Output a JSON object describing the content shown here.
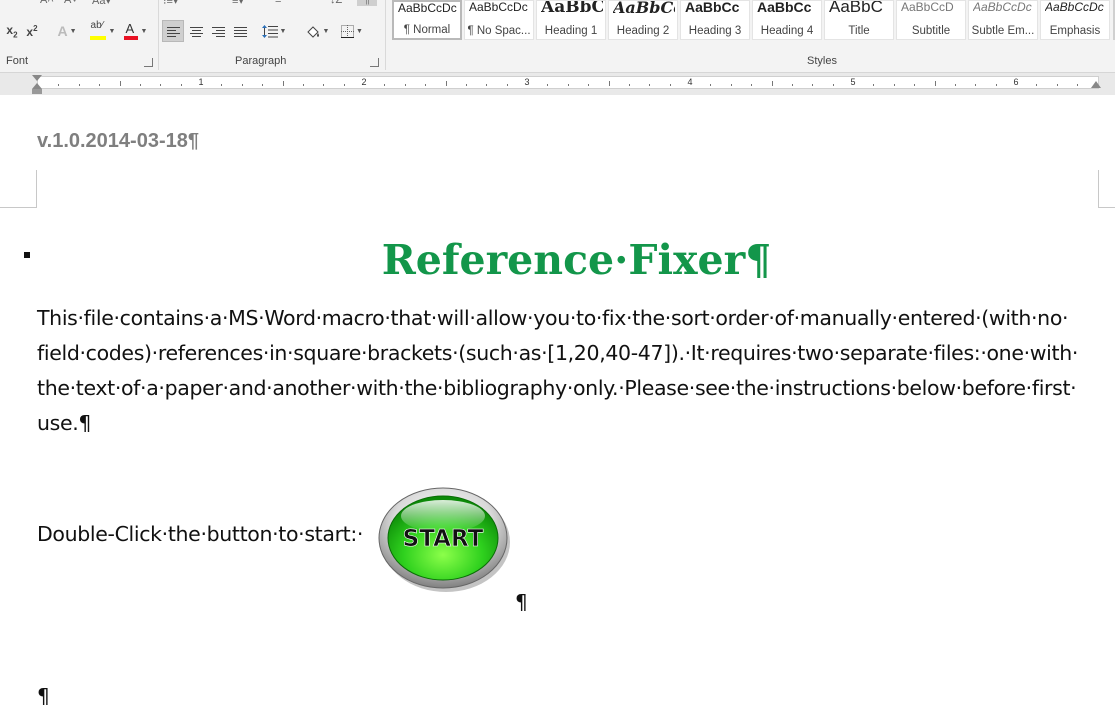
{
  "ribbon": {
    "font_group_label": "Font",
    "paragraph_group_label": "Paragraph",
    "styles_group_label": "Styles",
    "styles": [
      {
        "preview": "AaBbCcDc",
        "name": "¶ Normal",
        "selected": true
      },
      {
        "preview": "AaBbCcDc",
        "name": "¶ No Spac..."
      },
      {
        "preview": "AaBbC(",
        "name": "Heading 1"
      },
      {
        "preview": "AaBbCc",
        "name": "Heading 2"
      },
      {
        "preview": "AaBbCc",
        "name": "Heading 3"
      },
      {
        "preview": "AaBbCc",
        "name": "Heading 4"
      },
      {
        "preview": "AaBbC",
        "name": "Title"
      },
      {
        "preview": "AaBbCcD",
        "name": "Subtitle"
      },
      {
        "preview": "AaBbCcDc",
        "name": "Subtle Em..."
      },
      {
        "preview": "AaBbCcDc",
        "name": "Emphasis"
      }
    ],
    "icons": {
      "subscript": "subscript-icon",
      "superscript": "superscript-icon",
      "text_effects": "text-effects-icon",
      "highlight": "highlight-icon",
      "font_color": "font-color-icon",
      "align_left": "align-left-icon",
      "align_center": "align-center-icon",
      "align_right": "align-right-icon",
      "justify": "justify-icon",
      "line_spacing": "line-spacing-icon",
      "shading": "shading-icon",
      "borders": "borders-icon"
    },
    "colors": {
      "highlight": "#ffff00",
      "font_color": "#e81123"
    }
  },
  "ruler": {
    "numbers": [
      "1",
      "2",
      "3",
      "4",
      "5",
      "6"
    ]
  },
  "document": {
    "header_text": "v.1.0.2014-03-18¶",
    "title": "Reference·Fixer¶",
    "title_color": "#13964a",
    "body_lines": [
      "This·file·contains·a·MS·Word·macro·that·will·allow·you·to·fix·the·sort·order·of·manually·entered·(with·no·",
      "field·codes)·references·in·square·brackets·(such·as·[1,20,40-47]).·It·requires·two·separate·files:·one·with·",
      "the·text·of·a·paper·and·another·with·the·bibliography·only.·Please·see·the·instructions·below·before·first·",
      "use.¶"
    ],
    "double_click_text": "Double-Click·the·button·to·start:·",
    "start_button_label": "START",
    "pilcrow_after_button": "¶",
    "empty_paragraph": "¶"
  }
}
